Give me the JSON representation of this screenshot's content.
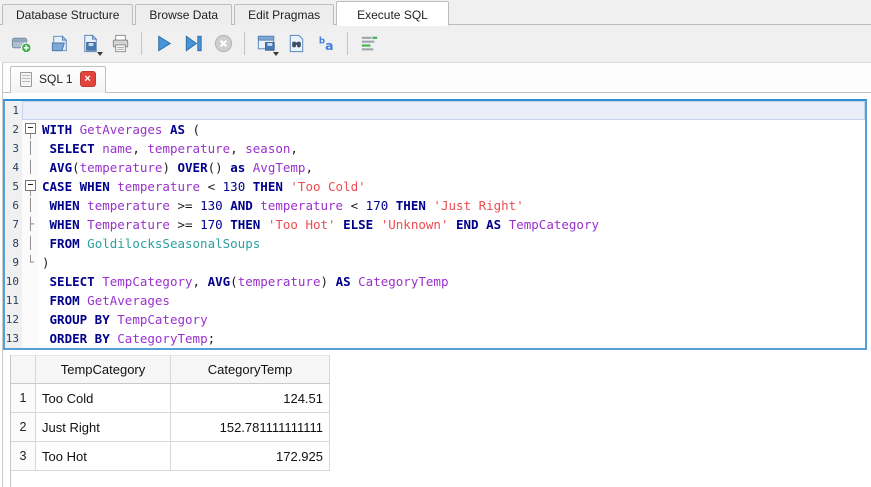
{
  "main_tabs": {
    "items": [
      {
        "label": "Database Structure",
        "active": false
      },
      {
        "label": "Browse Data",
        "active": false
      },
      {
        "label": "Edit Pragmas",
        "active": false
      },
      {
        "label": "Execute SQL",
        "active": true
      }
    ]
  },
  "toolbar": {
    "items": [
      {
        "name": "open-sql-tab-button",
        "icon": "newtab",
        "first": true
      },
      {
        "name": "open-sql-file-button",
        "icon": "openfile"
      },
      {
        "name": "save-sql-file-button",
        "icon": "savefile",
        "dropdown": true
      },
      {
        "name": "print-button",
        "icon": "print"
      },
      {
        "type": "separator"
      },
      {
        "name": "execute-all-button",
        "icon": "play"
      },
      {
        "name": "execute-current-line-button",
        "icon": "playline"
      },
      {
        "name": "stop-button",
        "icon": "stop",
        "disabled": true
      },
      {
        "type": "separator"
      },
      {
        "name": "save-results-button",
        "icon": "saveresults",
        "dropdown": true
      },
      {
        "name": "find-button",
        "icon": "find"
      },
      {
        "name": "format-sql-button",
        "icon": "format"
      },
      {
        "type": "separator"
      },
      {
        "name": "query-history-button",
        "icon": "history"
      }
    ]
  },
  "sql_tab": {
    "label": "SQL 1",
    "close_glyph": "×"
  },
  "editor": {
    "current_line": 1,
    "lines": [
      {
        "num": "1",
        "fold": "",
        "current": true,
        "tokens": []
      },
      {
        "num": "2",
        "fold": "open",
        "tokens": [
          {
            "c": "kw",
            "t": "WITH"
          },
          {
            "c": "pl",
            "t": " "
          },
          {
            "c": "id",
            "t": "GetAverages"
          },
          {
            "c": "pl",
            "t": " "
          },
          {
            "c": "kw",
            "t": "AS"
          },
          {
            "c": "pn",
            "t": " ("
          }
        ]
      },
      {
        "num": "3",
        "fold": "line",
        "tokens": [
          {
            "c": "pl",
            "t": " "
          },
          {
            "c": "kw",
            "t": "SELECT"
          },
          {
            "c": "pl",
            "t": " "
          },
          {
            "c": "id",
            "t": "name"
          },
          {
            "c": "pn",
            "t": ", "
          },
          {
            "c": "id",
            "t": "temperature"
          },
          {
            "c": "pn",
            "t": ", "
          },
          {
            "c": "id",
            "t": "season"
          },
          {
            "c": "pn",
            "t": ","
          }
        ]
      },
      {
        "num": "4",
        "fold": "line",
        "tokens": [
          {
            "c": "pl",
            "t": " "
          },
          {
            "c": "kw",
            "t": "AVG"
          },
          {
            "c": "pn",
            "t": "("
          },
          {
            "c": "id",
            "t": "temperature"
          },
          {
            "c": "pn",
            "t": ") "
          },
          {
            "c": "kw",
            "t": "OVER"
          },
          {
            "c": "pn",
            "t": "() "
          },
          {
            "c": "kw",
            "t": "as"
          },
          {
            "c": "pl",
            "t": " "
          },
          {
            "c": "id",
            "t": "AvgTemp"
          },
          {
            "c": "pn",
            "t": ","
          }
        ]
      },
      {
        "num": "5",
        "fold": "open",
        "tokens": [
          {
            "c": "kw",
            "t": "CASE"
          },
          {
            "c": "pl",
            "t": " "
          },
          {
            "c": "kw",
            "t": "WHEN"
          },
          {
            "c": "pl",
            "t": " "
          },
          {
            "c": "id",
            "t": "temperature"
          },
          {
            "c": "pn",
            "t": " < "
          },
          {
            "c": "nb",
            "t": "130"
          },
          {
            "c": "pl",
            "t": " "
          },
          {
            "c": "kw",
            "t": "THEN"
          },
          {
            "c": "pl",
            "t": " "
          },
          {
            "c": "str",
            "t": "'Too Cold'"
          }
        ]
      },
      {
        "num": "6",
        "fold": "line",
        "tokens": [
          {
            "c": "pl",
            "t": " "
          },
          {
            "c": "kw",
            "t": "WHEN"
          },
          {
            "c": "pl",
            "t": " "
          },
          {
            "c": "id",
            "t": "temperature"
          },
          {
            "c": "pn",
            "t": " >= "
          },
          {
            "c": "nb",
            "t": "130"
          },
          {
            "c": "pl",
            "t": " "
          },
          {
            "c": "kw",
            "t": "AND"
          },
          {
            "c": "pl",
            "t": " "
          },
          {
            "c": "id",
            "t": "temperature"
          },
          {
            "c": "pn",
            "t": " < "
          },
          {
            "c": "nb",
            "t": "170"
          },
          {
            "c": "pl",
            "t": " "
          },
          {
            "c": "kw",
            "t": "THEN"
          },
          {
            "c": "pl",
            "t": " "
          },
          {
            "c": "str",
            "t": "'Just Right'"
          }
        ]
      },
      {
        "num": "7",
        "fold": "tick",
        "tokens": [
          {
            "c": "pl",
            "t": " "
          },
          {
            "c": "kw",
            "t": "WHEN"
          },
          {
            "c": "pl",
            "t": " "
          },
          {
            "c": "id",
            "t": "Temperature"
          },
          {
            "c": "pn",
            "t": " >= "
          },
          {
            "c": "nb",
            "t": "170"
          },
          {
            "c": "pl",
            "t": " "
          },
          {
            "c": "kw",
            "t": "THEN"
          },
          {
            "c": "pl",
            "t": " "
          },
          {
            "c": "str",
            "t": "'Too Hot'"
          },
          {
            "c": "pl",
            "t": " "
          },
          {
            "c": "kw",
            "t": "ELSE"
          },
          {
            "c": "pl",
            "t": " "
          },
          {
            "c": "str",
            "t": "'Unknown'"
          },
          {
            "c": "pl",
            "t": " "
          },
          {
            "c": "kw",
            "t": "END"
          },
          {
            "c": "pl",
            "t": " "
          },
          {
            "c": "kw",
            "t": "AS"
          },
          {
            "c": "pl",
            "t": " "
          },
          {
            "c": "id",
            "t": "TempCategory"
          }
        ]
      },
      {
        "num": "8",
        "fold": "line",
        "tokens": [
          {
            "c": "pl",
            "t": " "
          },
          {
            "c": "kw",
            "t": "FROM"
          },
          {
            "c": "pl",
            "t": " "
          },
          {
            "c": "tbl",
            "t": "GoldilocksSeasonalSoups"
          }
        ]
      },
      {
        "num": "9",
        "fold": "end",
        "tokens": [
          {
            "c": "pn",
            "t": ")"
          }
        ]
      },
      {
        "num": "10",
        "fold": "",
        "tokens": [
          {
            "c": "pl",
            "t": " "
          },
          {
            "c": "kw",
            "t": "SELECT"
          },
          {
            "c": "pl",
            "t": " "
          },
          {
            "c": "id",
            "t": "TempCategory"
          },
          {
            "c": "pn",
            "t": ", "
          },
          {
            "c": "kw",
            "t": "AVG"
          },
          {
            "c": "pn",
            "t": "("
          },
          {
            "c": "id",
            "t": "temperature"
          },
          {
            "c": "pn",
            "t": ") "
          },
          {
            "c": "kw",
            "t": "AS"
          },
          {
            "c": "pl",
            "t": " "
          },
          {
            "c": "id",
            "t": "CategoryTemp"
          }
        ]
      },
      {
        "num": "11",
        "fold": "",
        "tokens": [
          {
            "c": "pl",
            "t": " "
          },
          {
            "c": "kw",
            "t": "FROM"
          },
          {
            "c": "pl",
            "t": " "
          },
          {
            "c": "id",
            "t": "GetAverages"
          }
        ]
      },
      {
        "num": "12",
        "fold": "",
        "tokens": [
          {
            "c": "pl",
            "t": " "
          },
          {
            "c": "kw",
            "t": "GROUP BY"
          },
          {
            "c": "pl",
            "t": " "
          },
          {
            "c": "id",
            "t": "TempCategory"
          }
        ]
      },
      {
        "num": "13",
        "fold": "",
        "tokens": [
          {
            "c": "pl",
            "t": " "
          },
          {
            "c": "kw",
            "t": "ORDER BY"
          },
          {
            "c": "pl",
            "t": " "
          },
          {
            "c": "id",
            "t": "CategoryTemp"
          },
          {
            "c": "pn",
            "t": ";"
          }
        ]
      }
    ]
  },
  "results": {
    "columns": [
      "TempCategory",
      "CategoryTemp"
    ],
    "rows": [
      {
        "n": "1",
        "cells": [
          "Too Cold",
          "124.51"
        ]
      },
      {
        "n": "2",
        "cells": [
          "Just Right",
          "152.781111111111"
        ]
      },
      {
        "n": "3",
        "cells": [
          "Too Hot",
          "172.925"
        ]
      }
    ]
  },
  "colors": {
    "keyword": "#00008b",
    "identifier": "#9932cc",
    "string": "#ee4c50",
    "number": "#00008b",
    "table_name": "#2aa0a0",
    "line_highlight": "#e9eef9",
    "editor_focus_border": "#54a0d6",
    "close_button_red": "#e0443c",
    "toolbar_accent_blue": "#4795d8",
    "chrome_gray": "#f0f0f0"
  }
}
